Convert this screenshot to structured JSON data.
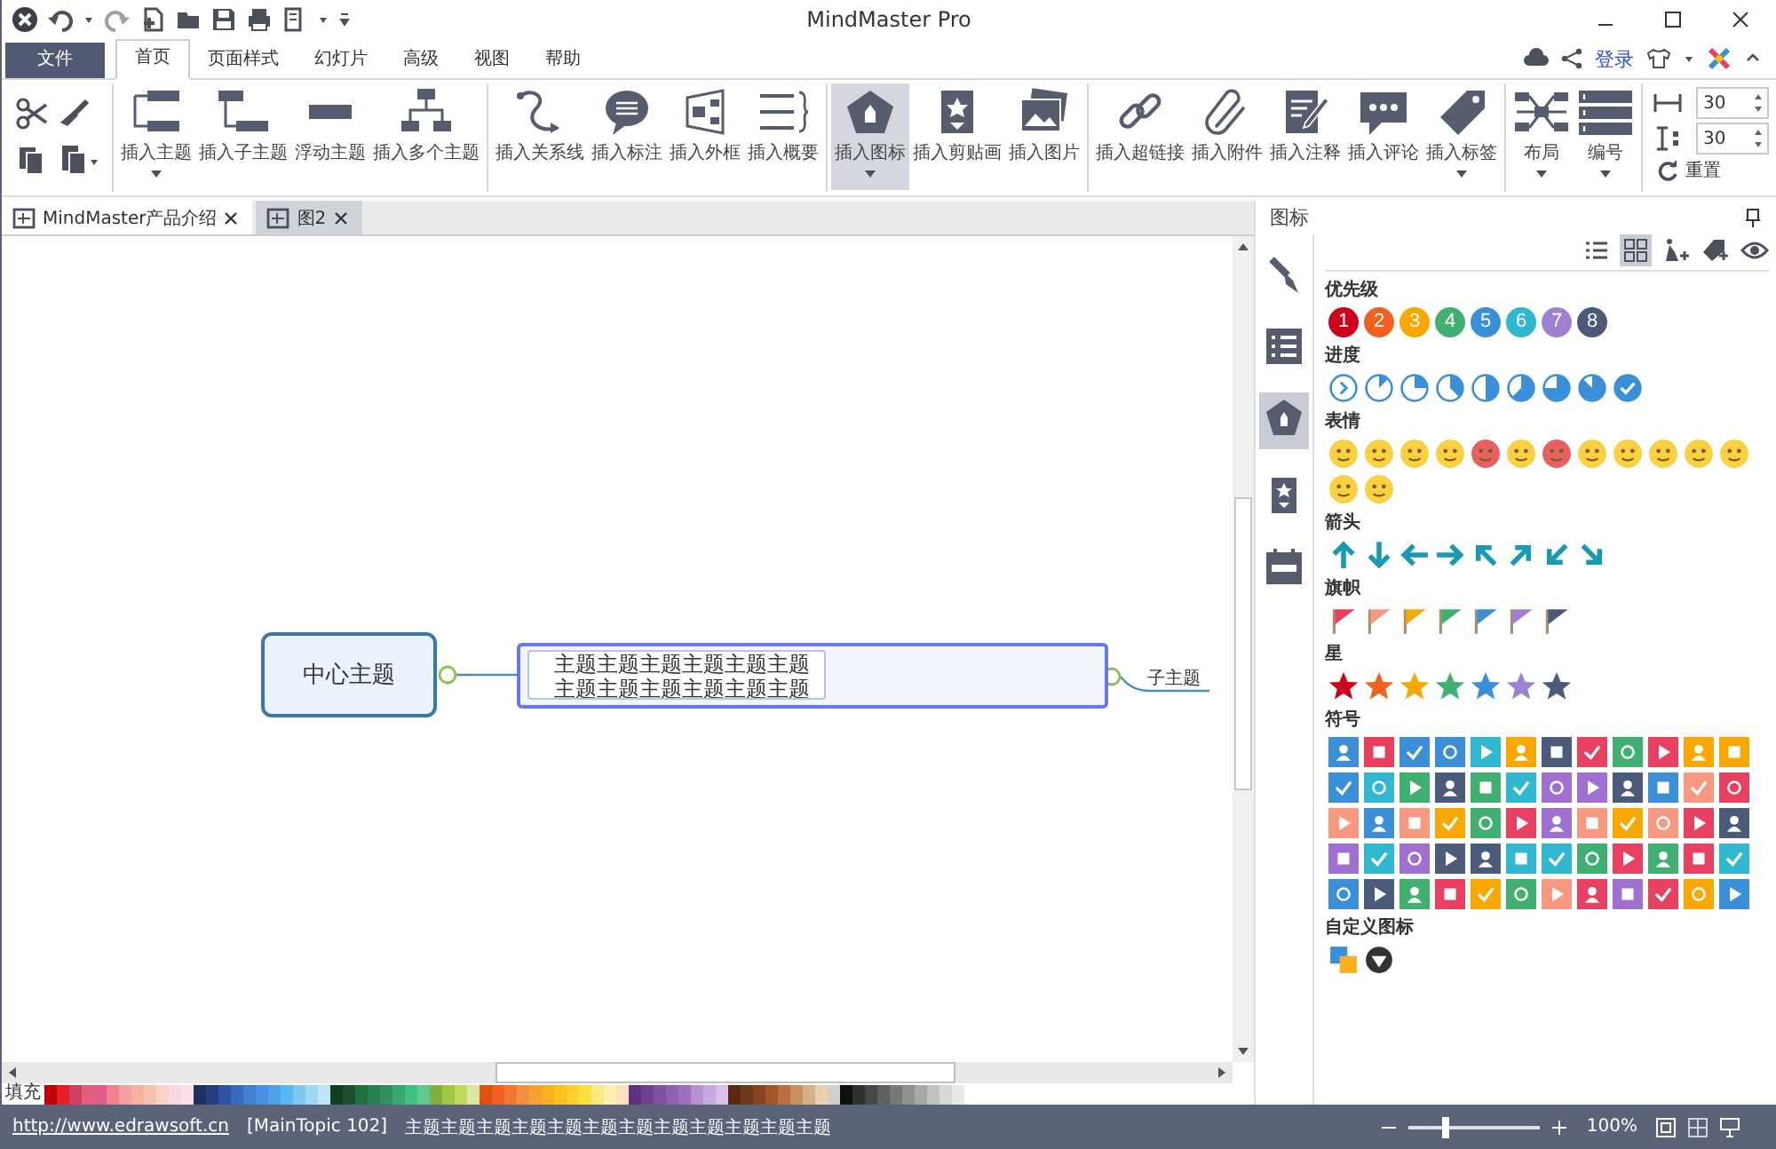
{
  "window": {
    "title": "MindMaster Pro"
  },
  "menu_tabs": [
    {
      "label": "文件",
      "kind": "file",
      "selected": false
    },
    {
      "label": "首页",
      "kind": "tab",
      "selected": true
    },
    {
      "label": "页面样式",
      "kind": "tab",
      "selected": false
    },
    {
      "label": "幻灯片",
      "kind": "tab",
      "selected": false
    },
    {
      "label": "高级",
      "kind": "tab",
      "selected": false
    },
    {
      "label": "视图",
      "kind": "tab",
      "selected": false
    },
    {
      "label": "帮助",
      "kind": "tab",
      "selected": false
    }
  ],
  "login": "登录",
  "ribbon_groups": [
    {
      "buttons": [
        {
          "label": "插入主题",
          "kind": "topic",
          "dropdown": true,
          "selected": false
        },
        {
          "label": "插入子主题",
          "kind": "subtopic",
          "dropdown": false,
          "selected": false
        },
        {
          "label": "浮动主题",
          "kind": "float",
          "dropdown": false,
          "selected": false
        },
        {
          "label": "插入多个主题",
          "kind": "multi",
          "dropdown": false,
          "selected": false
        }
      ]
    },
    {
      "buttons": [
        {
          "label": "插入关系线",
          "kind": "relation",
          "dropdown": false,
          "selected": false
        },
        {
          "label": "插入标注",
          "kind": "callout",
          "dropdown": false,
          "selected": false
        },
        {
          "label": "插入外框",
          "kind": "boundary",
          "dropdown": false,
          "selected": false
        },
        {
          "label": "插入概要",
          "kind": "summary",
          "dropdown": false,
          "selected": false
        }
      ]
    },
    {
      "buttons": [
        {
          "label": "插入图标",
          "kind": "icon",
          "dropdown": true,
          "selected": true
        },
        {
          "label": "插入剪贴画",
          "kind": "clipart",
          "dropdown": false,
          "selected": false
        },
        {
          "label": "插入图片",
          "kind": "image",
          "dropdown": false,
          "selected": false
        }
      ]
    },
    {
      "buttons": [
        {
          "label": "插入超链接",
          "kind": "link",
          "dropdown": false,
          "selected": false
        },
        {
          "label": "插入附件",
          "kind": "attachment",
          "dropdown": false,
          "selected": false
        },
        {
          "label": "插入注释",
          "kind": "note",
          "dropdown": false,
          "selected": false
        },
        {
          "label": "插入评论",
          "kind": "comment",
          "dropdown": false,
          "selected": false
        },
        {
          "label": "插入标签",
          "kind": "tag",
          "dropdown": true,
          "selected": false
        }
      ]
    },
    {
      "buttons": [
        {
          "label": "布局",
          "kind": "layout",
          "dropdown": true,
          "selected": false
        },
        {
          "label": "编号",
          "kind": "numbering",
          "dropdown": true,
          "selected": false
        }
      ]
    }
  ],
  "spacing_fields": [
    "30",
    "30"
  ],
  "reset": "重置",
  "doc_tabs": [
    {
      "label": "MindMaster产品介绍",
      "selected": false
    },
    {
      "label": "图2",
      "selected": true
    }
  ],
  "map": {
    "central": "中心主题",
    "main_topic": "主题主题主题主题主题主题主题主题主题主题主题主题",
    "subtopic": "子主题"
  },
  "palette": {
    "label": "填充",
    "colors": [
      {
        "color": "#c00000"
      },
      {
        "color": "#e8202a"
      },
      {
        "color": "#d04060"
      },
      {
        "color": "#e06080"
      },
      {
        "color": "#e05a8a"
      },
      {
        "color": "#f08090"
      },
      {
        "color": "#f4a0a0"
      },
      {
        "color": "#f8b0a0"
      },
      {
        "color": "#f4c0b0"
      },
      {
        "color": "#fcd0c8"
      },
      {
        "color": "#f8d8e0"
      },
      {
        "color": "#fde0e8"
      },
      {
        "color": "#203060"
      },
      {
        "color": "#283c80"
      },
      {
        "color": "#3050a0"
      },
      {
        "color": "#3868c0"
      },
      {
        "color": "#4080d0"
      },
      {
        "color": "#4890e0"
      },
      {
        "color": "#50a0e8"
      },
      {
        "color": "#58b8f0"
      },
      {
        "color": "#80c8f0"
      },
      {
        "color": "#a0d8f0"
      },
      {
        "color": "#c0e4f4"
      },
      {
        "color": "#104020"
      },
      {
        "color": "#1a5030"
      },
      {
        "color": "#207040"
      },
      {
        "color": "#288050"
      },
      {
        "color": "#309060"
      },
      {
        "color": "#38a870"
      },
      {
        "color": "#40c080"
      },
      {
        "color": "#60c890"
      },
      {
        "color": "#80b040"
      },
      {
        "color": "#a0c840"
      },
      {
        "color": "#c0d860"
      },
      {
        "color": "#d8e8a0"
      },
      {
        "color": "#e05010"
      },
      {
        "color": "#f06020"
      },
      {
        "color": "#f07830"
      },
      {
        "color": "#f49040"
      },
      {
        "color": "#f8a030"
      },
      {
        "color": "#f8b020"
      },
      {
        "color": "#fcc020"
      },
      {
        "color": "#fcd030"
      },
      {
        "color": "#fce040"
      },
      {
        "color": "#fce880"
      },
      {
        "color": "#fcf0b0"
      },
      {
        "color": "#f8e0c0"
      },
      {
        "color": "#603080"
      },
      {
        "color": "#704090"
      },
      {
        "color": "#8050a0"
      },
      {
        "color": "#9060b0"
      },
      {
        "color": "#a070c0"
      },
      {
        "color": "#b890d0"
      },
      {
        "color": "#c8a8e0"
      },
      {
        "color": "#d8c0e8"
      },
      {
        "color": "#5a2a10"
      },
      {
        "color": "#703818"
      },
      {
        "color": "#884420"
      },
      {
        "color": "#a05828"
      },
      {
        "color": "#b87040"
      },
      {
        "color": "#c89060"
      },
      {
        "color": "#d8b088"
      },
      {
        "color": "#e8d0b0"
      },
      {
        "color": "#d0d0c8"
      },
      {
        "color": "#101010"
      },
      {
        "color": "#303030"
      },
      {
        "color": "#484848"
      },
      {
        "color": "#606060"
      },
      {
        "color": "#787878"
      },
      {
        "color": "#909090"
      },
      {
        "color": "#a8a8a8"
      },
      {
        "color": "#c0c0c0"
      },
      {
        "color": "#d8d8d8"
      },
      {
        "color": "#e8e8e8"
      }
    ]
  },
  "panel": {
    "title": "图标",
    "icon_groups": [
      {
        "title": "优先级",
        "kind": "priority",
        "items": [
          {
            "label": "1",
            "color": "#d0021b"
          },
          {
            "label": "2",
            "color": "#f06020"
          },
          {
            "label": "3",
            "color": "#f8a800"
          },
          {
            "label": "4",
            "color": "#40b070"
          },
          {
            "label": "5",
            "color": "#3a8fd8"
          },
          {
            "label": "6",
            "color": "#30b8d0"
          },
          {
            "label": "7",
            "color": "#a080d0"
          },
          {
            "label": "8",
            "color": "#4a5a78"
          }
        ]
      },
      {
        "title": "进度",
        "kind": "progress",
        "items": [
          {
            "kind": "start"
          },
          {
            "kind": "p1"
          },
          {
            "kind": "p2"
          },
          {
            "kind": "p3"
          },
          {
            "kind": "p4"
          },
          {
            "kind": "p5"
          },
          {
            "kind": "p6"
          },
          {
            "kind": "p7"
          },
          {
            "kind": "done"
          }
        ]
      },
      {
        "title": "表情",
        "kind": "emoji",
        "items": [
          {
            "color": "#f8d040"
          },
          {
            "color": "#f8d040"
          },
          {
            "color": "#f8d040"
          },
          {
            "color": "#f8d040"
          },
          {
            "color": "#e86060"
          },
          {
            "color": "#f8d040"
          },
          {
            "color": "#e86060"
          },
          {
            "color": "#f8d040"
          },
          {
            "color": "#f8d040"
          },
          {
            "color": "#f8d040"
          },
          {
            "color": "#f8d040"
          },
          {
            "color": "#f8d040"
          },
          {
            "color": "#f8d040"
          },
          {
            "color": "#f8d040"
          }
        ]
      },
      {
        "title": "箭头",
        "kind": "arrow",
        "items": [
          {
            "kind": "up"
          },
          {
            "kind": "down"
          },
          {
            "kind": "left"
          },
          {
            "kind": "right"
          },
          {
            "kind": "up-left"
          },
          {
            "kind": "up-right"
          },
          {
            "kind": "down-left"
          },
          {
            "kind": "down-right"
          }
        ]
      },
      {
        "title": "旗帜",
        "kind": "flag",
        "items": [
          {
            "color": "#e84060"
          },
          {
            "color": "#f89880"
          },
          {
            "color": "#f8a800"
          },
          {
            "color": "#40b070"
          },
          {
            "color": "#3a8fd8"
          },
          {
            "color": "#a080d0"
          },
          {
            "color": "#4a5a78"
          }
        ]
      },
      {
        "title": "星",
        "kind": "star",
        "items": [
          {
            "color": "#d0021b"
          },
          {
            "color": "#f06020"
          },
          {
            "color": "#f8a800"
          },
          {
            "color": "#40b070"
          },
          {
            "color": "#3a8fd8"
          },
          {
            "color": "#a080d0"
          },
          {
            "color": "#4a5a78"
          }
        ]
      },
      {
        "title": "符号",
        "kind": "symbol",
        "items": [
          {
            "color": "#3a8fd8"
          },
          {
            "color": "#e8405a"
          },
          {
            "color": "#3a8fd8"
          },
          {
            "color": "#3a8fd8"
          },
          {
            "color": "#30b8d0"
          },
          {
            "color": "#f8a800"
          },
          {
            "color": "#4a5a78"
          },
          {
            "color": "#e84060"
          },
          {
            "color": "#40b070"
          },
          {
            "color": "#e84060"
          },
          {
            "color": "#f8a800"
          },
          {
            "color": "#f8a800"
          },
          {
            "color": "#3a8fd8"
          },
          {
            "color": "#30b8d0"
          },
          {
            "color": "#40b070"
          },
          {
            "color": "#4a5a78"
          },
          {
            "color": "#40b070"
          },
          {
            "color": "#30b8d0"
          },
          {
            "color": "#a070d0"
          },
          {
            "color": "#a070d0"
          },
          {
            "color": "#4a5a78"
          },
          {
            "color": "#3a8fd8"
          },
          {
            "color": "#f89880"
          },
          {
            "color": "#e84060"
          },
          {
            "color": "#f89880"
          },
          {
            "color": "#3a8fd8"
          },
          {
            "color": "#f89880"
          },
          {
            "color": "#f8a800"
          },
          {
            "color": "#40b070"
          },
          {
            "color": "#e84060"
          },
          {
            "color": "#a070d0"
          },
          {
            "color": "#f89880"
          },
          {
            "color": "#f8a800"
          },
          {
            "color": "#f89880"
          },
          {
            "color": "#e84060"
          },
          {
            "color": "#4a5a78"
          },
          {
            "color": "#a070d0"
          },
          {
            "color": "#30b8d0"
          },
          {
            "color": "#a070d0"
          },
          {
            "color": "#4a5a78"
          },
          {
            "color": "#4a5a78"
          },
          {
            "color": "#30b8d0"
          },
          {
            "color": "#30b8d0"
          },
          {
            "color": "#40b070"
          },
          {
            "color": "#e84060"
          },
          {
            "color": "#40b070"
          },
          {
            "color": "#e84060"
          },
          {
            "color": "#30b8d0"
          },
          {
            "color": "#3a8fd8"
          },
          {
            "color": "#4a5a78"
          },
          {
            "color": "#40b070"
          },
          {
            "color": "#e84060"
          },
          {
            "color": "#f8a800"
          },
          {
            "color": "#40b070"
          },
          {
            "color": "#f89880"
          },
          {
            "color": "#e84060"
          },
          {
            "color": "#a070d0"
          },
          {
            "color": "#e84060"
          },
          {
            "color": "#f8a800"
          },
          {
            "color": "#3a8fd8"
          }
        ]
      },
      {
        "title": "自定义图标",
        "kind": "custom",
        "items": [
          {
            "kind": "app"
          },
          {
            "kind": "badge"
          }
        ]
      }
    ]
  },
  "status_bar": {
    "link": "http://www.edrawsoft.cn",
    "topic_id": "[MainTopic 102]",
    "topic_text": "主题主题主题主题主题主题主题主题主题主题主题主题",
    "zoom": {
      "level": 0.25
    },
    "zoom_reading": "100%"
  }
}
